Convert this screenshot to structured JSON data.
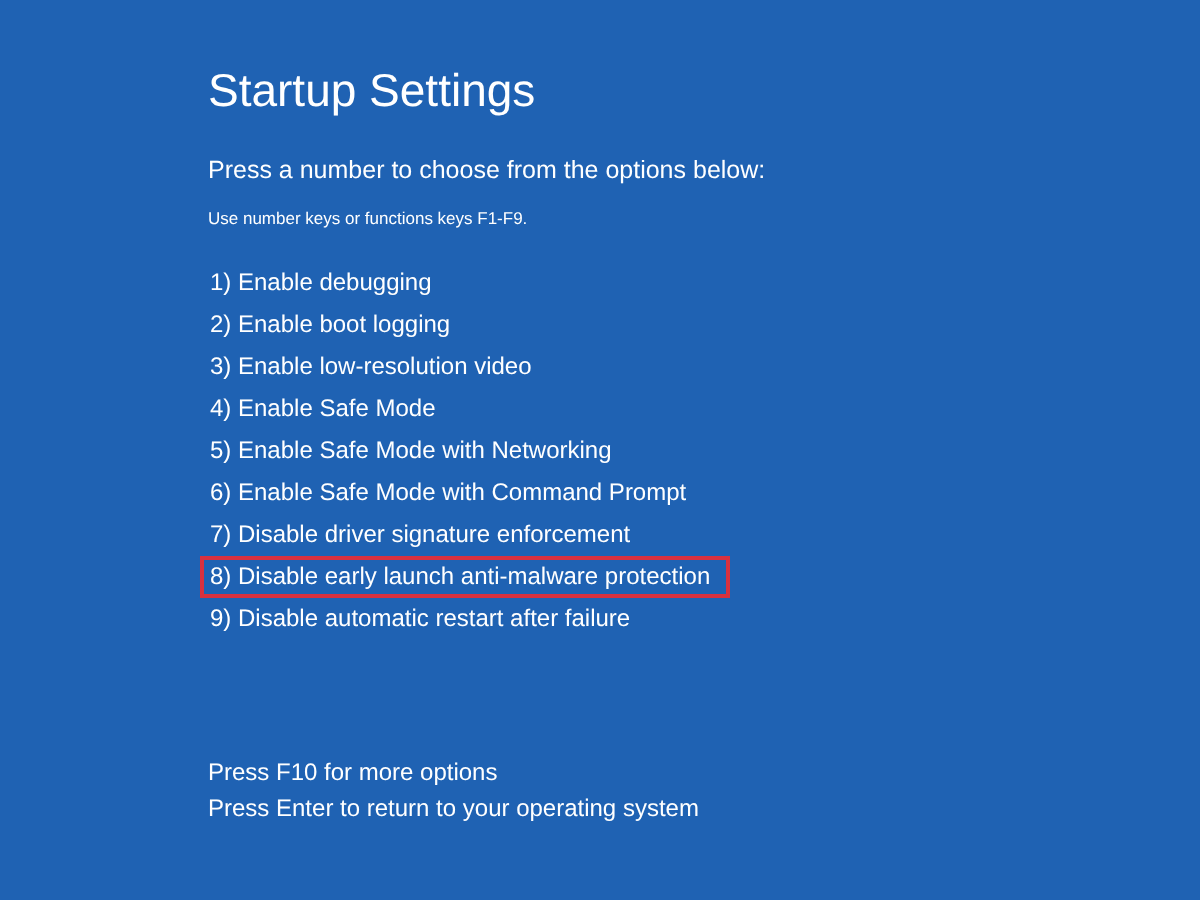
{
  "title": "Startup Settings",
  "instruction": "Press a number to choose from the options below:",
  "hint": "Use number keys or functions keys F1-F9.",
  "options": [
    {
      "label": "1) Enable debugging",
      "highlighted": false
    },
    {
      "label": "2) Enable boot logging",
      "highlighted": false
    },
    {
      "label": "3) Enable low-resolution video",
      "highlighted": false
    },
    {
      "label": "4) Enable Safe Mode",
      "highlighted": false
    },
    {
      "label": "5) Enable Safe Mode with Networking",
      "highlighted": false
    },
    {
      "label": "6) Enable Safe Mode with Command Prompt",
      "highlighted": false
    },
    {
      "label": "7) Disable driver signature enforcement",
      "highlighted": false
    },
    {
      "label": "8) Disable early launch anti-malware protection",
      "highlighted": true
    },
    {
      "label": "9) Disable automatic restart after failure",
      "highlighted": false
    }
  ],
  "footer": [
    "Press F10 for more options",
    "Press Enter to return to your operating system"
  ]
}
